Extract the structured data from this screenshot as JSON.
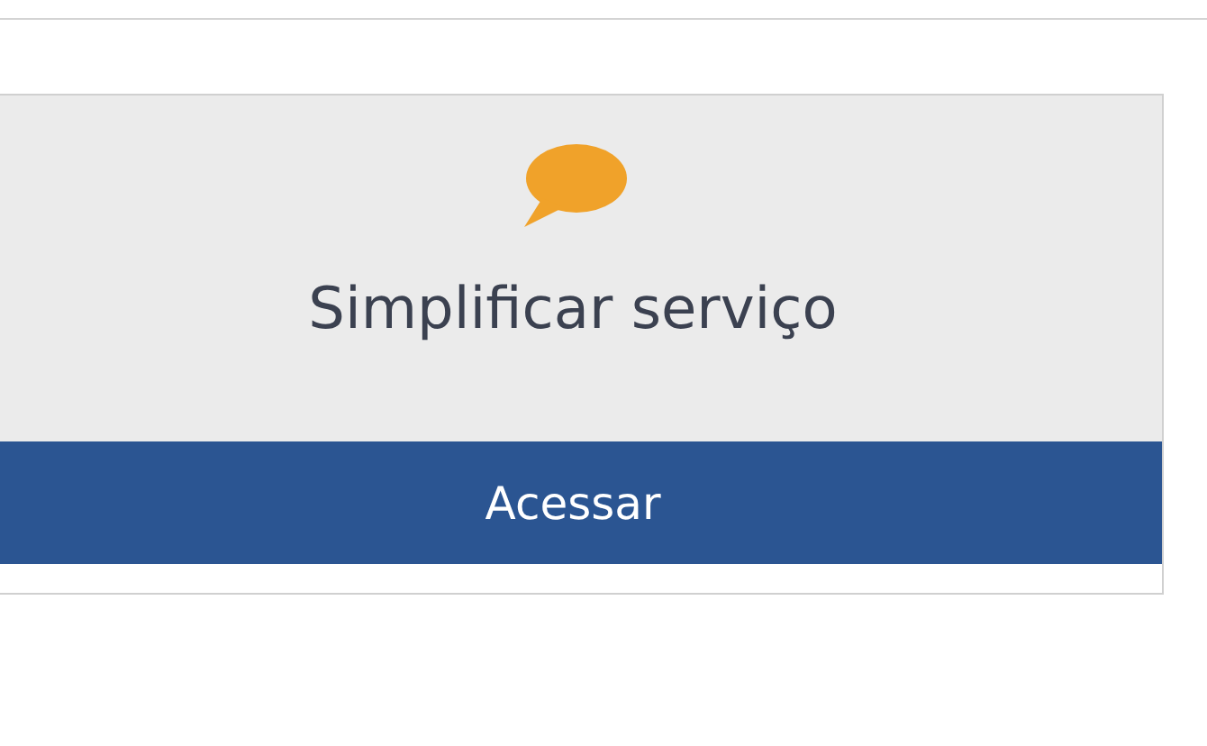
{
  "service_card": {
    "title": "Simplificar serviço",
    "button": "Acessar"
  }
}
